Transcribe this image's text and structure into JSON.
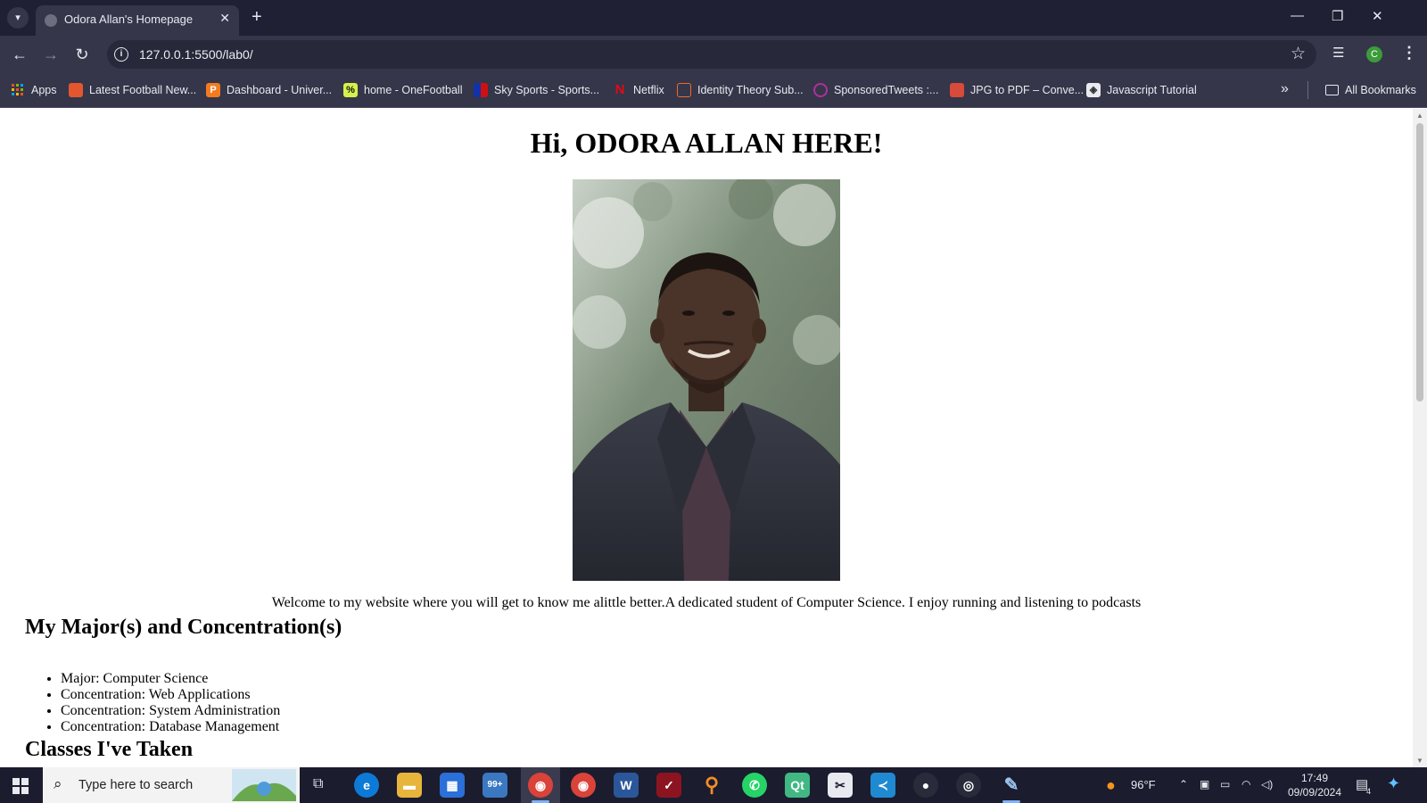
{
  "browser": {
    "tab_title": "Odora Allan's Homepage",
    "url": "127.0.0.1:5500/lab0/",
    "profile_initial": "C",
    "bookmarks": [
      {
        "label": "Apps",
        "icon": "apps-grid-icon"
      },
      {
        "label": "Latest Football New...",
        "icon": "football-news-icon"
      },
      {
        "label": "Dashboard - Univer...",
        "icon": "dashboard-p-icon"
      },
      {
        "label": "home - OneFootball",
        "icon": "onefootball-icon"
      },
      {
        "label": "Sky Sports - Sports...",
        "icon": "sky-sports-icon"
      },
      {
        "label": "Netflix",
        "icon": "netflix-icon"
      },
      {
        "label": "Identity Theory Sub...",
        "icon": "identity-theory-icon"
      },
      {
        "label": "SponsoredTweets :...",
        "icon": "sponsoredtweets-icon"
      },
      {
        "label": "JPG to PDF – Conve...",
        "icon": "jpg-pdf-icon"
      },
      {
        "label": "Javascript Tutorial",
        "icon": "javascript-tutorial-icon"
      }
    ],
    "all_bookmarks_label": "All Bookmarks"
  },
  "page": {
    "heading": "Hi, ODORA ALLAN HERE!",
    "welcome": "Welcome to my website where you will get to know me alittle better.A dedicated student of Computer Science. I enjoy running and listening to podcasts",
    "majors_heading": "My Major(s) and Concentration(s)",
    "majors": [
      "Major: Computer Science",
      "Concentration: Web Applications",
      "Concentration: System Administration",
      "Concentration: Database Management"
    ],
    "classes_heading": "Classes I've Taken"
  },
  "taskbar": {
    "search_placeholder": "Type here to search",
    "mail_badge": "99+",
    "weather": "96°F",
    "time": "17:49",
    "date": "09/09/2024",
    "notification_count": "4"
  },
  "colors": {
    "chrome_dark": "#1f2033",
    "chrome_toolbar": "#35364a",
    "taskbar": "#1b1c2e",
    "profile_green": "#3c9b3a"
  }
}
